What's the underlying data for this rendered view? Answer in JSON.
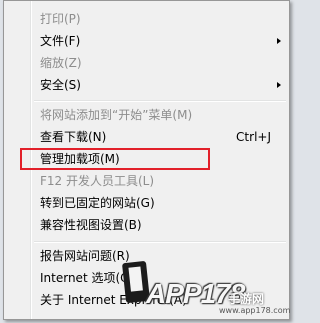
{
  "menu": {
    "items": [
      {
        "label": "打印(P)",
        "disabled": true
      },
      {
        "label": "文件(F)",
        "submenu": true
      },
      {
        "label": "缩放(Z)",
        "disabled": true
      },
      {
        "label": "安全(S)",
        "submenu": true
      },
      {
        "label": "将网站添加到“开始”菜单(M)",
        "disabled": true
      },
      {
        "label": "查看下载(N)",
        "shortcut": "Ctrl+J"
      },
      {
        "label": "管理加载项(M)",
        "highlighted": true
      },
      {
        "label": "F12 开发人员工具(L)",
        "disabled": true
      },
      {
        "label": "转到已固定的网站(G)"
      },
      {
        "label": "兼容性视图设置(B)"
      },
      {
        "label": "报告网站问题(R)"
      },
      {
        "label": "Internet 选项(O)"
      },
      {
        "label": "关于 Internet Explorer(A)"
      }
    ]
  },
  "highlight_color": "#e2202a",
  "watermark": {
    "brand": "APP178",
    "sub": "手游网",
    "url": "www.app178.com"
  }
}
